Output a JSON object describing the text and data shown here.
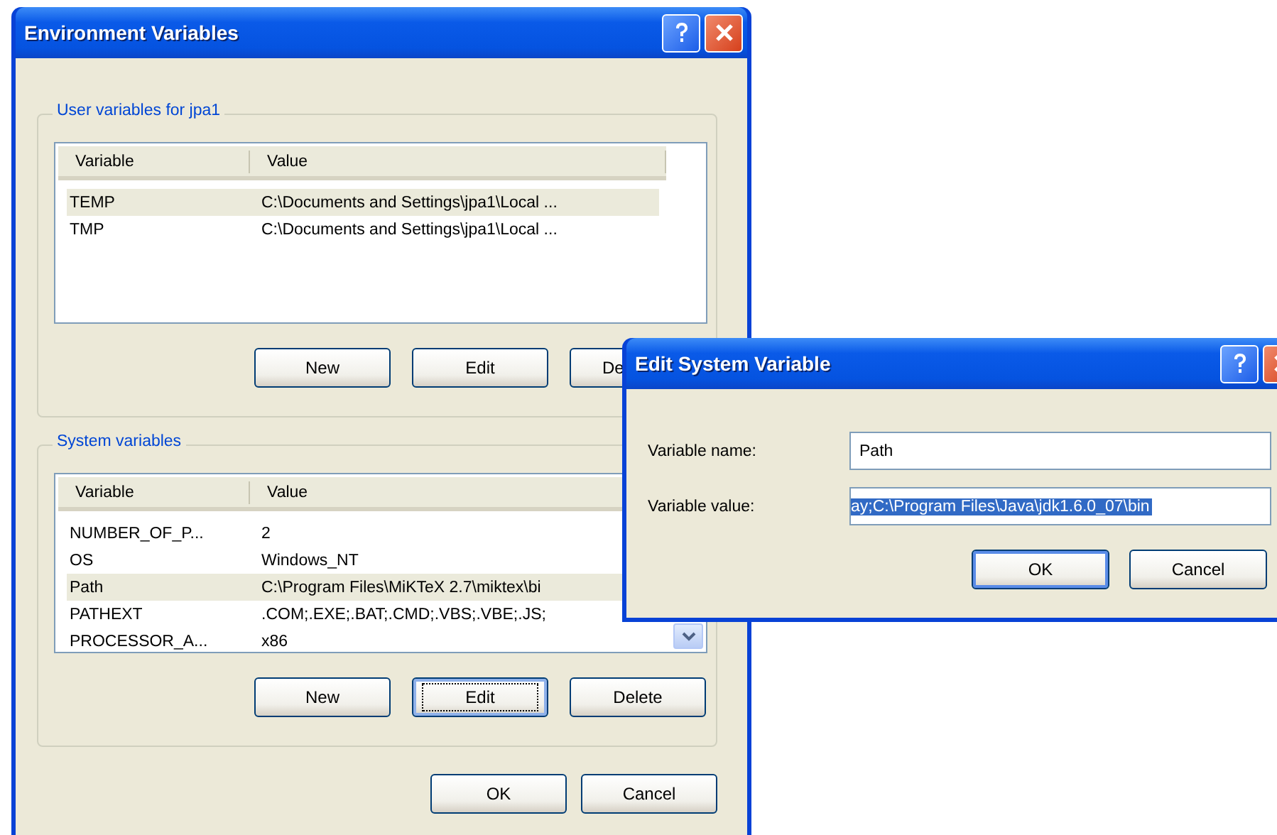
{
  "main_window": {
    "title": "Environment Variables",
    "groups": [
      {
        "label": "User variables for jpa1",
        "columns": [
          "Variable",
          "Value"
        ],
        "scroll_arrow": false,
        "rows": [
          {
            "variable": "TEMP",
            "value": "C:\\Documents and Settings\\jpa1\\Local ...",
            "selected": true
          },
          {
            "variable": "TMP",
            "value": "C:\\Documents and Settings\\jpa1\\Local ...",
            "selected": false
          }
        ],
        "buttons": [
          {
            "label": "New",
            "focused": false,
            "cut": false
          },
          {
            "label": "Edit",
            "focused": false,
            "cut": false
          },
          {
            "label": "De",
            "focused": false,
            "cut": true
          }
        ]
      },
      {
        "label": "System variables",
        "columns": [
          "Variable",
          "Value"
        ],
        "scroll_arrow": true,
        "rows": [
          {
            "variable": "NUMBER_OF_P...",
            "value": "2",
            "selected": false
          },
          {
            "variable": "OS",
            "value": "Windows_NT",
            "selected": false
          },
          {
            "variable": "Path",
            "value": "C:\\Program Files\\MiKTeX 2.7\\miktex\\bi",
            "selected": true
          },
          {
            "variable": "PATHEXT",
            "value": ".COM;.EXE;.BAT;.CMD;.VBS;.VBE;.JS;",
            "selected": false
          },
          {
            "variable": "PROCESSOR_A...",
            "value": "x86",
            "selected": false
          }
        ],
        "buttons": [
          {
            "label": "New",
            "focused": false,
            "cut": false
          },
          {
            "label": "Edit",
            "focused": true,
            "cut": false
          },
          {
            "label": "Delete",
            "focused": false,
            "cut": false
          }
        ]
      }
    ],
    "buttons": [
      {
        "label": "OK",
        "default": false
      },
      {
        "label": "Cancel",
        "default": false
      }
    ]
  },
  "edit_dialog": {
    "title": "Edit System Variable",
    "fields": [
      {
        "label": "Variable name:",
        "value": "Path",
        "text_selected": false
      },
      {
        "label": "Variable value:",
        "value": "ay;C:\\Program Files\\Java\\jdk1.6.0_07\\bin",
        "text_selected": true
      }
    ],
    "buttons": [
      {
        "label": "OK",
        "default": true
      },
      {
        "label": "Cancel",
        "default": false
      }
    ]
  }
}
